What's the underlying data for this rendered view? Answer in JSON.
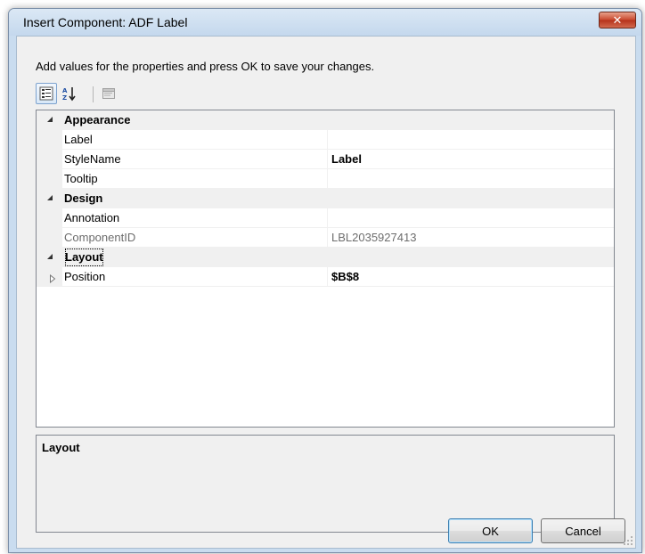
{
  "window": {
    "title": "Insert Component: ADF Label",
    "close_label": "✕"
  },
  "instruction": "Add values for the properties and press OK to save your changes.",
  "toolbar": {
    "buttons": [
      "categorized-view",
      "alphabetical-sort",
      "property-pages"
    ]
  },
  "grid": {
    "categories": [
      {
        "name": "Appearance",
        "expanded": true,
        "properties": [
          {
            "name": "Label",
            "value": ""
          },
          {
            "name": "StyleName",
            "value": "Label"
          },
          {
            "name": "Tooltip",
            "value": ""
          }
        ]
      },
      {
        "name": "Design",
        "expanded": true,
        "properties": [
          {
            "name": "Annotation",
            "value": ""
          },
          {
            "name": "ComponentID",
            "value": "LBL2035927413"
          }
        ]
      },
      {
        "name": "Layout",
        "expanded": true,
        "properties": [
          {
            "name": "Position",
            "value": "$B$8"
          }
        ]
      }
    ]
  },
  "description": {
    "title": "Layout"
  },
  "buttons": {
    "ok": "OK",
    "cancel": "Cancel"
  }
}
